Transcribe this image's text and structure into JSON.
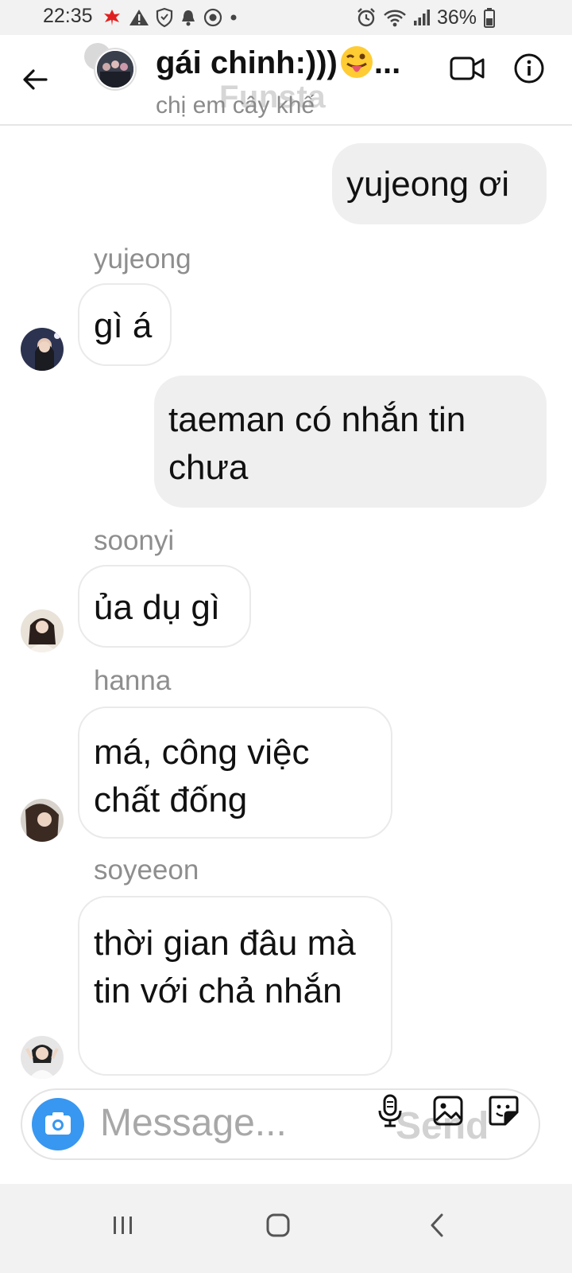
{
  "status_bar": {
    "time": "22:35",
    "battery": "36%",
    "left_icons": [
      "notification-app-icon",
      "warning-icon",
      "shield-icon",
      "bell-icon",
      "vpn-icon",
      "dot-icon"
    ],
    "right_icons": [
      "alarm-icon",
      "wifi-icon",
      "signal-icon",
      "battery-icon"
    ]
  },
  "header": {
    "title": "gái chinh:)))",
    "title_emoji": "😛",
    "title_ellipsis": "...",
    "subtitle": "chị em cây khế",
    "watermark": "Funsta"
  },
  "messages": [
    {
      "direction": "out",
      "text": "yujeong ơi"
    },
    {
      "direction": "in",
      "sender": "yujeong",
      "text": "gì á"
    },
    {
      "direction": "out",
      "text": "taeman có nhắn tin chưa"
    },
    {
      "direction": "in",
      "sender": "soonyi",
      "text": "ủa dụ gì"
    },
    {
      "direction": "in",
      "sender": "hanna",
      "text": "má, công việc chất đống"
    },
    {
      "direction": "in",
      "sender": "soyeeon",
      "text": "thời gian đâu mà tin với chả nhắn"
    }
  ],
  "composer": {
    "placeholder": "Message...",
    "send_watermark": "Send"
  },
  "colors": {
    "accent": "#3897f0",
    "outgoing_bubble": "#efefef",
    "incoming_border": "#eaeaea",
    "sender_name": "#8e8e8e"
  }
}
